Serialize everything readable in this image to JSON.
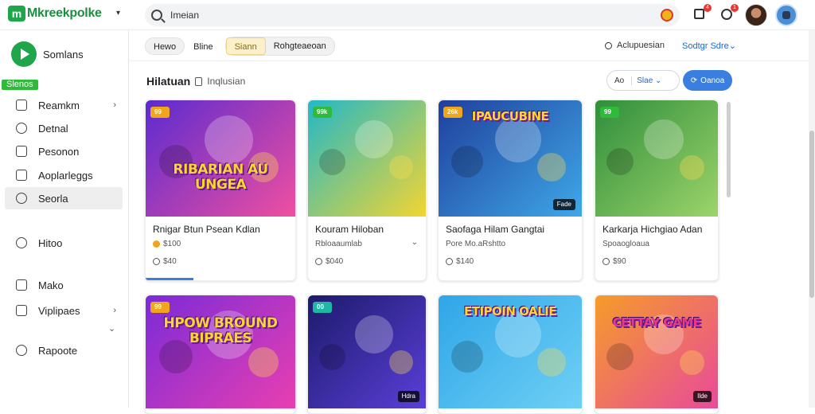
{
  "header": {
    "app_name": "Mkreekpolke",
    "logo_letter": "m",
    "search_value": "Imeian",
    "notif_count": "4",
    "chat_count": "1"
  },
  "sidebar": {
    "brand_label": "Somlans",
    "section_tag": "Slenos",
    "items": [
      {
        "label": "Reamkm",
        "icon": "bookmark-icon",
        "has_chevron": true
      },
      {
        "label": "Detnal",
        "icon": "gamepad-icon",
        "has_chevron": false
      },
      {
        "label": "Pesonon",
        "icon": "folder-icon",
        "has_chevron": false
      },
      {
        "label": "Aoplarleggs",
        "icon": "shield-icon",
        "has_chevron": false
      },
      {
        "label": "Seorla",
        "icon": "controller-icon",
        "has_chevron": false,
        "active": true
      },
      {
        "label": "Hitoo",
        "icon": "history-icon",
        "has_chevron": false
      },
      {
        "label": "Mako",
        "icon": "document-icon",
        "has_chevron": false
      },
      {
        "label": "Viplipaes",
        "icon": "list-icon",
        "has_chevron": true
      },
      {
        "label": "Rapoote",
        "icon": "report-icon",
        "has_chevron": false
      }
    ]
  },
  "filters": {
    "chips": [
      "Hewo",
      "Bline",
      "Siann",
      "Rohgteaeoan"
    ],
    "selected": "Siann",
    "sort_label": "Aclupuesian",
    "sort_dropdown": "Sodtgr Sdre"
  },
  "section": {
    "title": "Hilatuan",
    "subtitle": "Inqlusian",
    "segment_a": "Ao",
    "segment_b": "Slae",
    "primary_button": "Oanoa"
  },
  "cards": [
    {
      "title": "Rnigar Btun Psean Kdlan",
      "meta": "$100",
      "stat": "$40",
      "badge": "99",
      "thumb_title": "RIBARIAN AU UNGEA",
      "corner": "",
      "has_chevron": false,
      "has_coin": true,
      "has_progress": true,
      "colors": {
        "bg1": "#5b2bd0",
        "bg2": "#f04fa0",
        "badge": "#f2a51a",
        "title": "#ffd431"
      }
    },
    {
      "title": "Kouram Hiloban",
      "meta": "Rbloaaumlab",
      "stat": "$040",
      "badge": "99k",
      "thumb_title": "",
      "corner": "",
      "has_chevron": true,
      "has_coin": false,
      "has_progress": false,
      "colors": {
        "bg1": "#22b8c8",
        "bg2": "#f2d532",
        "badge": "#2ebb3a",
        "title": "#ffffff"
      }
    },
    {
      "title": "Saofaga Hilam Gangtai",
      "meta": "Pore Mo.aRshtto",
      "stat": "$140",
      "badge": "26k",
      "thumb_title": "IPAUCUBINE",
      "corner": "Fade",
      "has_chevron": false,
      "has_coin": false,
      "has_progress": false,
      "colors": {
        "bg1": "#1f3f9c",
        "bg2": "#3fa8e8",
        "badge": "#f2a51a",
        "title": "#ffd431"
      }
    },
    {
      "title": "Karkarja Hichgiao Adan",
      "meta": "Spoaogloaua",
      "stat": "$90",
      "badge": "99",
      "thumb_title": "",
      "corner": "",
      "has_chevron": false,
      "has_coin": false,
      "has_progress": false,
      "colors": {
        "bg1": "#2f8e3c",
        "bg2": "#9dd46a",
        "badge": "#2ebb3a",
        "title": "#ffffff"
      }
    },
    {
      "title": "",
      "meta": "",
      "stat": "",
      "badge": "99",
      "thumb_title": "HPOW BROUND BIPRAES",
      "corner": "",
      "has_chevron": false,
      "has_coin": false,
      "has_progress": false,
      "colors": {
        "bg1": "#7b2bd8",
        "bg2": "#e93fb0",
        "badge": "#f2a51a",
        "title": "#ffd431"
      }
    },
    {
      "title": "",
      "meta": "",
      "stat": "",
      "badge": "00",
      "thumb_title": "",
      "corner": "Hdra",
      "has_chevron": false,
      "has_coin": false,
      "has_progress": false,
      "colors": {
        "bg1": "#1d1a6b",
        "bg2": "#5a3fd8",
        "badge": "#1fb6a6",
        "title": "#ffffff"
      }
    },
    {
      "title": "",
      "meta": "",
      "stat": "",
      "badge": "",
      "thumb_title": "ETIPOIN OALIE",
      "corner": "",
      "has_chevron": false,
      "has_coin": false,
      "has_progress": false,
      "colors": {
        "bg1": "#2fa6e8",
        "bg2": "#6fd0f5",
        "badge": "#f2a51a",
        "title": "#ffd431"
      }
    },
    {
      "title": "",
      "meta": "",
      "stat": "",
      "badge": "",
      "thumb_title": "CETTAY GAME",
      "corner": "Ilde",
      "has_chevron": false,
      "has_coin": false,
      "has_progress": false,
      "colors": {
        "bg1": "#f59c2a",
        "bg2": "#e94a9a",
        "badge": "#f2a51a",
        "title": "#e63a8a"
      }
    }
  ]
}
